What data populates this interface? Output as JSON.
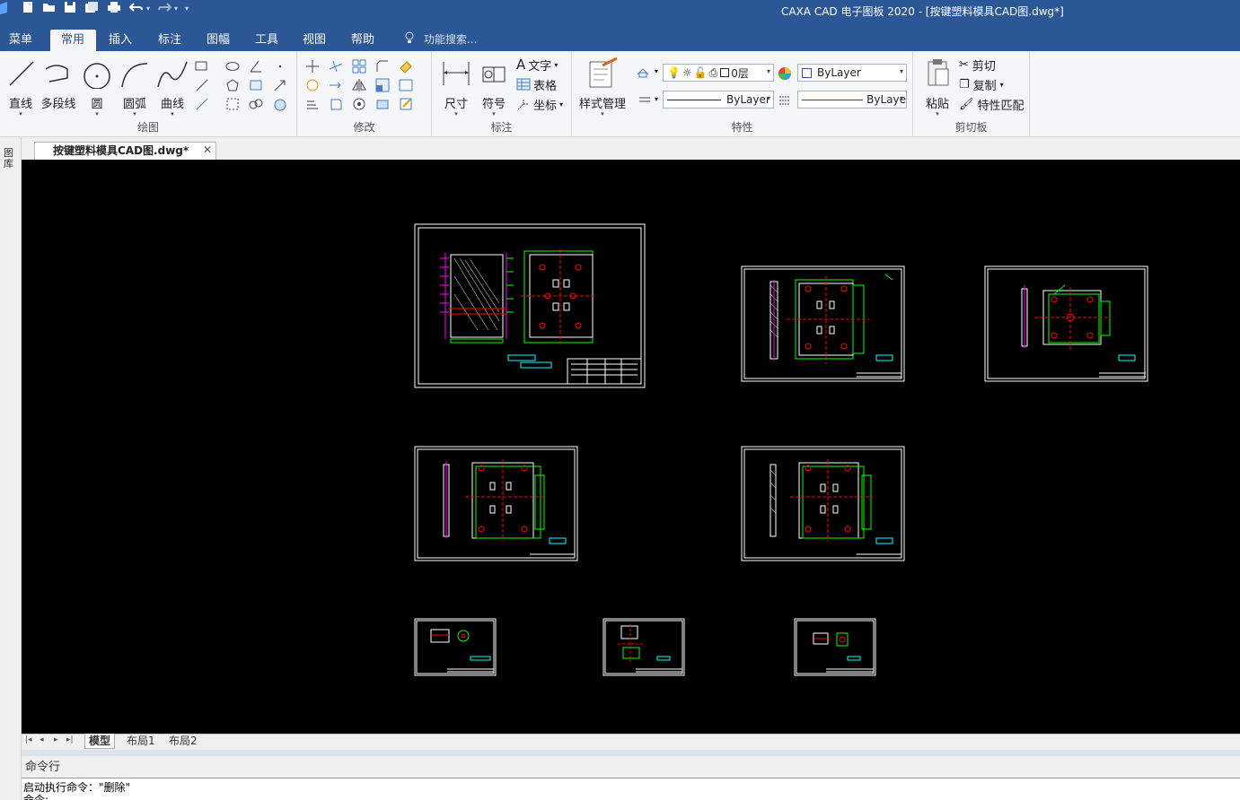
{
  "window": {
    "title": "CAXA CAD 电子图板 2020 - [按键塑料模具CAD图.dwg*]"
  },
  "menu": {
    "tabs": [
      {
        "label": "菜单"
      },
      {
        "label": "常用"
      },
      {
        "label": "插入"
      },
      {
        "label": "标注"
      },
      {
        "label": "图幅"
      },
      {
        "label": "工具"
      },
      {
        "label": "视图"
      },
      {
        "label": "帮助"
      }
    ],
    "active_index": 1,
    "search_placeholder": "功能搜索..."
  },
  "ribbon": {
    "groups": {
      "draw": {
        "label": "绘图",
        "buttons": [
          {
            "label": "直线",
            "icon": "line-icon"
          },
          {
            "label": "多段线",
            "icon": "polyline-icon"
          },
          {
            "label": "圆",
            "icon": "circle-icon"
          },
          {
            "label": "圆弧",
            "icon": "arc-icon"
          },
          {
            "label": "曲线",
            "icon": "spline-icon"
          }
        ]
      },
      "modify": {
        "label": "修改"
      },
      "annotate": {
        "label": "标注",
        "buttons": [
          {
            "label": "尺寸",
            "icon": "dimension-icon"
          },
          {
            "label": "符号",
            "icon": "symbol-icon"
          }
        ],
        "small": [
          {
            "label": "文字",
            "icon": "text-icon"
          },
          {
            "label": "表格",
            "icon": "table-icon"
          },
          {
            "label": "坐标",
            "icon": "coordinate-icon"
          }
        ]
      },
      "properties": {
        "label": "特性",
        "style_manager_label": "样式管理",
        "layer_value": "0层",
        "color_value": "ByLayer",
        "linetype_value": "ByLayer",
        "lineweight_value": "ByLaye"
      },
      "clipboard": {
        "label": "剪切板",
        "paste_label": "粘贴",
        "cut_label": "剪切",
        "copy_label": "复制",
        "match_label": "特性匹配"
      }
    }
  },
  "document": {
    "tab_label": "按键塑料模具CAD图.dwg*",
    "left_panel_label": "图库"
  },
  "layouts": {
    "tabs": [
      {
        "label": "模型"
      },
      {
        "label": "布局1"
      },
      {
        "label": "布局2"
      }
    ],
    "active_index": 0
  },
  "command": {
    "title": "命令行",
    "line1": "启动执行命令：\"删除\"",
    "line2": "命令:"
  },
  "colors": {
    "titlebar": "#2b5797",
    "canvas": "#000000",
    "drawing_white": "#ffffff",
    "drawing_green": "#00ff00",
    "drawing_red": "#ff0000",
    "drawing_magenta": "#ff00ff",
    "drawing_cyan": "#00ffff"
  }
}
